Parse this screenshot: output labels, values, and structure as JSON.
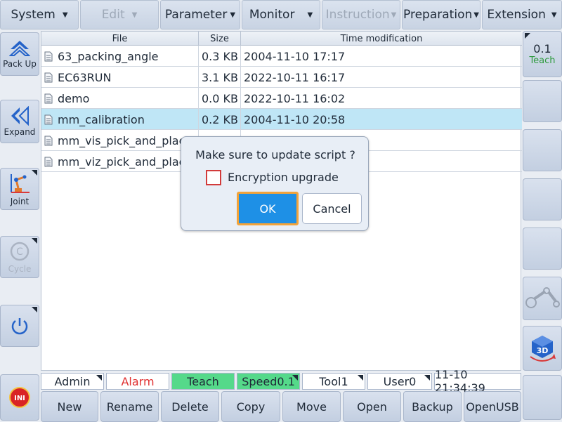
{
  "menu": {
    "items": [
      {
        "label": "System",
        "enabled": true
      },
      {
        "label": "Edit",
        "enabled": false
      },
      {
        "label": "Parameter",
        "enabled": true
      },
      {
        "label": "Monitor",
        "enabled": true
      },
      {
        "label": "Instruction",
        "enabled": false
      },
      {
        "label": "Preparation",
        "enabled": true
      },
      {
        "label": "Extension",
        "enabled": true
      }
    ]
  },
  "left_sidebar": {
    "pack_up": "Pack Up",
    "expand": "Expand",
    "joint": "Joint",
    "cycle": "Cycle",
    "ini_badge": "INI"
  },
  "right_sidebar": {
    "speed_value": "0.1",
    "mode": "Teach",
    "view_3d_label": "3D"
  },
  "table": {
    "columns": [
      "File",
      "Size",
      "Time modification"
    ],
    "rows": [
      {
        "file": "63_packing_angle",
        "size": "0.3 KB",
        "time": "2004-11-10 17:17",
        "selected": false
      },
      {
        "file": "EC63RUN",
        "size": "3.1 KB",
        "time": "2022-10-11 16:17",
        "selected": false
      },
      {
        "file": "demo",
        "size": "0.0 KB",
        "time": "2022-10-11 16:02",
        "selected": false
      },
      {
        "file": "mm_calibration",
        "size": "0.2 KB",
        "time": "2004-11-10 20:58",
        "selected": true
      },
      {
        "file": "mm_vis_pick_and_place",
        "size": "",
        "time": "",
        "selected": false
      },
      {
        "file": "mm_viz_pick_and_place",
        "size": "",
        "time": "",
        "selected": false
      }
    ]
  },
  "status_bar": {
    "user": "Admin",
    "alarm": "Alarm",
    "mode": "Teach",
    "speed": "Speed0.1",
    "tool": "Tool1",
    "user_frame": "User0",
    "datetime": "11-10 21:34:39"
  },
  "bottom_buttons": {
    "new": "New",
    "rename": "Rename",
    "delete": "Delete",
    "copy": "Copy",
    "move": "Move",
    "open": "Open",
    "backup": "Backup",
    "open_usb": "OpenUSB"
  },
  "dialog": {
    "message": "Make sure to update script ?",
    "checkbox_label": "Encryption upgrade",
    "checkbox_checked": false,
    "ok": "OK",
    "cancel": "Cancel"
  },
  "colors": {
    "alarm": "#e03030",
    "teach_bg": "#55d98a",
    "selected_row": "#bfe6f6",
    "ok_bg": "#1e90e6",
    "focus_border": "#f2a33a",
    "icon_blue": "#2563c9",
    "checkbox_border": "#d23b3b"
  },
  "icons": [
    "caret-down-icon",
    "pack-up-icon",
    "expand-icon",
    "joint-icon",
    "cycle-icon",
    "power-icon",
    "ini-icon",
    "file-icon",
    "robot-arm-icon",
    "3d-view-icon"
  ]
}
